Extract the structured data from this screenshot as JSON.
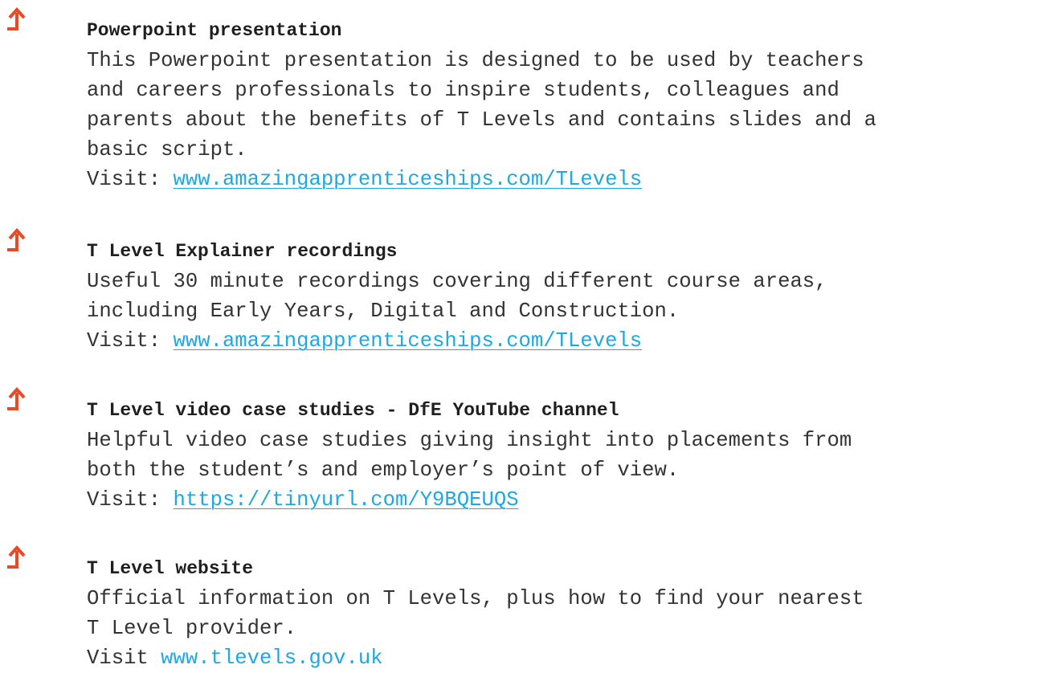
{
  "accent_color": "#e84a27",
  "link_color": "#1ea7e1",
  "resources": [
    {
      "icon": "turn-up-arrow-icon",
      "title": "Powerpoint presentation",
      "description": "This Powerpoint presentation is designed to be used by teachers\nand careers professionals to inspire students, colleagues and\nparents about the benefits of T Levels and contains slides and a\nbasic script.",
      "visit_label": "Visit: ",
      "link": "www.amazingapprenticeships.com/TLevels"
    },
    {
      "icon": "turn-up-arrow-icon",
      "title": "T Level Explainer recordings",
      "description": "Useful 30 minute recordings covering different course areas,\nincluding Early Years, Digital and Construction.",
      "visit_label": "Visit: ",
      "link": "www.amazingapprenticeships.com/TLevels"
    },
    {
      "icon": "turn-up-arrow-icon",
      "title": "T Level video case studies - DfE YouTube channel",
      "description": "Helpful video case studies giving insight into placements from\nboth the student’s and employer’s point of view.",
      "visit_label": "Visit: ",
      "link": "https://tinyurl.com/Y9BQEUQS"
    },
    {
      "icon": "turn-up-arrow-icon",
      "title": "T Level website",
      "description": "Official information on T Levels, plus how to find your nearest\nT Level provider.",
      "visit_label": "Visit ",
      "link": "www.tlevels.gov.uk"
    }
  ]
}
